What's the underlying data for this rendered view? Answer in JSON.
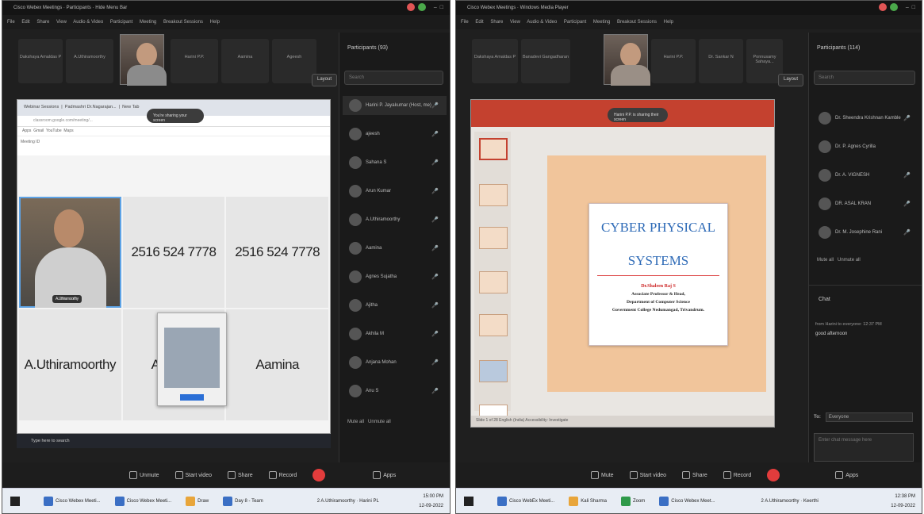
{
  "left": {
    "title_bar": "Cisco Webex Meetings · Participants · Hide Menu Bar",
    "menu_items": [
      "File",
      "Edit",
      "Share",
      "View",
      "Audio & Video",
      "Participant",
      "Meeting",
      "Breakout Sessions",
      "Help"
    ],
    "strip_tiles": [
      "Dakshaya Amaldas P",
      "A.Uthiramoorthy",
      "Harini P.P.",
      "Aamina",
      "Ageesh"
    ],
    "layout_label": "Layout",
    "participants_title": "Participants (93)",
    "search_placeholder": "Search",
    "participants": [
      "Harini P. Jayakumar (Host, me)",
      "ajeesh",
      "Sahana S",
      "Arun Kumar",
      "A.Uthiramoorthy",
      "Aamina",
      "Agnes Sujatha",
      "Ajitha",
      "Akhila M",
      "Anjana Mohan",
      "Anu S"
    ],
    "participants_footer": [
      "Mute all",
      "Unmute all"
    ],
    "browser_tabs": [
      "Webinar Sessions",
      "Padmashri Dr.Nagarajan...",
      "New Tab"
    ],
    "browser_url": "classroom.google.com/meeting/...",
    "bookmarks": [
      "Apps",
      "Gmail",
      "YouTube",
      "Maps"
    ],
    "page_header": "Meeting ID",
    "sharing_toast": "You're sharing your screen",
    "video_label": "A.Uthiramoorthy",
    "grid_cells": [
      "2516 524 7778",
      "2516 524 7778",
      "A.Uthiramoorthy",
      "Age",
      "Aamina"
    ],
    "os_bar": "Type here to search",
    "controls": [
      "Unmute",
      "Start video",
      "Share",
      "Record",
      "Apps"
    ],
    "taskbar_apps": [
      "Cisco Webex Meeti...",
      "Cisco Webex Meeti...",
      "Draw",
      "Day 8 - Team"
    ],
    "taskbar_right": "2 A.Uthiramoorthy · Harini PL",
    "clock_time": "15:00 PM",
    "clock_date": "12-09-2022"
  },
  "right": {
    "title_bar": "Cisco Webex Meetings · Windows Media Player",
    "menu_items": [
      "File",
      "Edit",
      "Share",
      "View",
      "Audio & Video",
      "Participant",
      "Meeting",
      "Breakout Sessions",
      "Help"
    ],
    "strip_tiles": [
      "Dakshaya Amaldas P",
      "Banadevi Gangadharan",
      "Harini P.P.",
      "Dr. Sankar N",
      "Ponnusamy Sahaya..."
    ],
    "layout_label": "Layout",
    "participants_title": "Participants (114)",
    "search_placeholder": "Search",
    "participants": [
      "Dr. Sheendra Krishnan Kamble",
      "Dr. P. Agnes Cyrilla",
      "Dr. A. VIGNESH",
      "DR. ASAL KRAN",
      "Dr. M. Josephine Rani"
    ],
    "participants_footer": [
      "Mute all",
      "Unmute all"
    ],
    "chat_title": "Chat",
    "chat_message": "from Harini to everyone: 12:37 PM",
    "chat_text": "good afternoon",
    "to_label": "To:",
    "to_value": "Everyone",
    "chat_placeholder": "Enter chat message here",
    "presenter_toast": "Harini P.P. is sharing their screen",
    "slide_title_1": "CYBER PHYSICAL",
    "slide_title_2": "SYSTEMS",
    "slide_name": "Dr.Shaleen Raj S",
    "slide_role": "Associate Professor & Head,",
    "slide_dept": "Department of Computer Science",
    "slide_college": "Government College Nedumangad, Trivandrum.",
    "ppt_status": "Slide 1 of 28   English (India)   Accessibility: Investigate",
    "controls": [
      "Mute",
      "Start video",
      "Share",
      "Record",
      "Apps"
    ],
    "taskbar_apps": [
      "Cisco WebEx Meeti...",
      "Kali Sharma",
      "Zoom",
      "Cisco Webex Meet..."
    ],
    "taskbar_right": "2 A.Uthiramoorthy · Keerthi",
    "clock_time": "12:38 PM",
    "clock_date": "12-09-2022"
  }
}
